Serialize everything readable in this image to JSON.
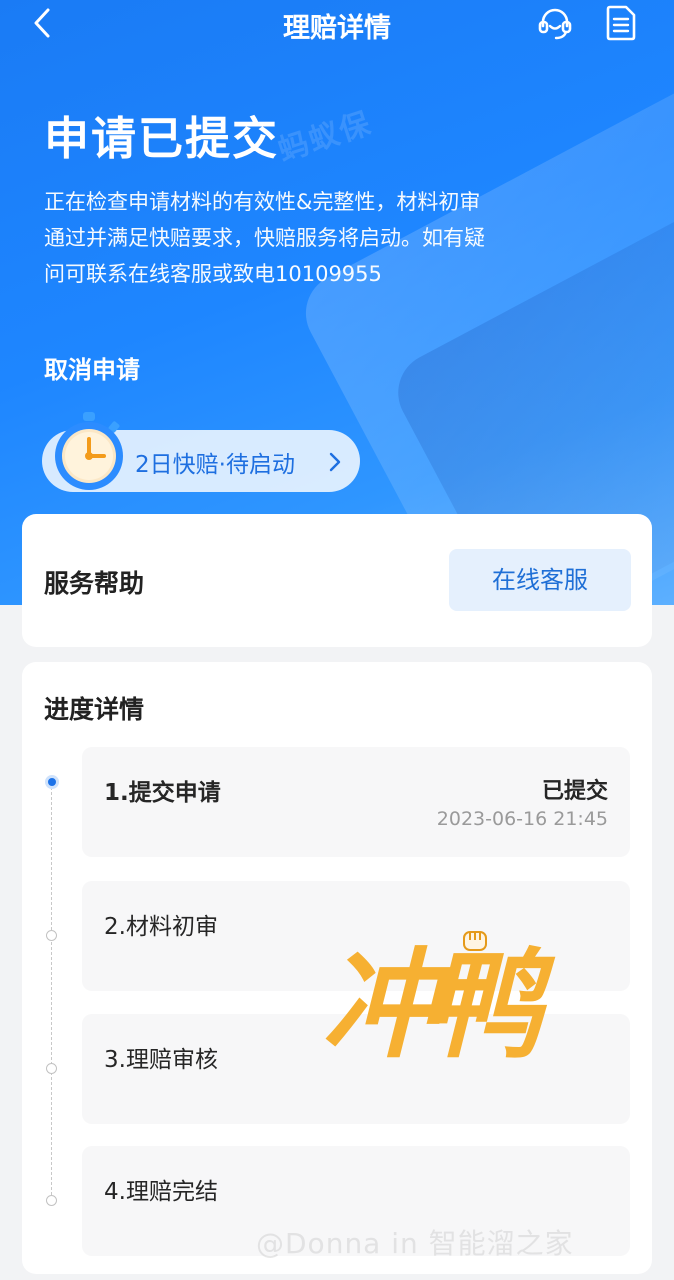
{
  "nav": {
    "title": "理赔详情",
    "icons": {
      "back": "chevron-left-icon",
      "service": "headset-icon",
      "doc": "document-icon"
    }
  },
  "hero": {
    "title": "申请已提交",
    "description": "正在检查申请材料的有效性&完整性，材料初审通过并满足快赔要求，快赔服务将启动。如有疑问可联系在线客服或致电10109955",
    "cancel": "取消申请",
    "pill_text": "2日快赔·待启动",
    "logo_watermark": "蚂蚁保"
  },
  "help": {
    "title": "服务帮助",
    "button": "在线客服"
  },
  "progress": {
    "title": "进度详情",
    "steps": [
      {
        "label": "1.提交申请",
        "state": "已提交",
        "time": "2023-06-16 21:45"
      },
      {
        "label": "2.材料初审"
      },
      {
        "label": "3.理赔审核"
      },
      {
        "label": "4.理赔完结"
      }
    ]
  },
  "overlays": {
    "sticker_text": "冲鸭",
    "watermark": "@Donna in 智能溜之家"
  },
  "colors": {
    "hero_blue": "#1e86ff",
    "accent_blue": "#1f6fd6",
    "sticker_orange": "#f6b032"
  }
}
